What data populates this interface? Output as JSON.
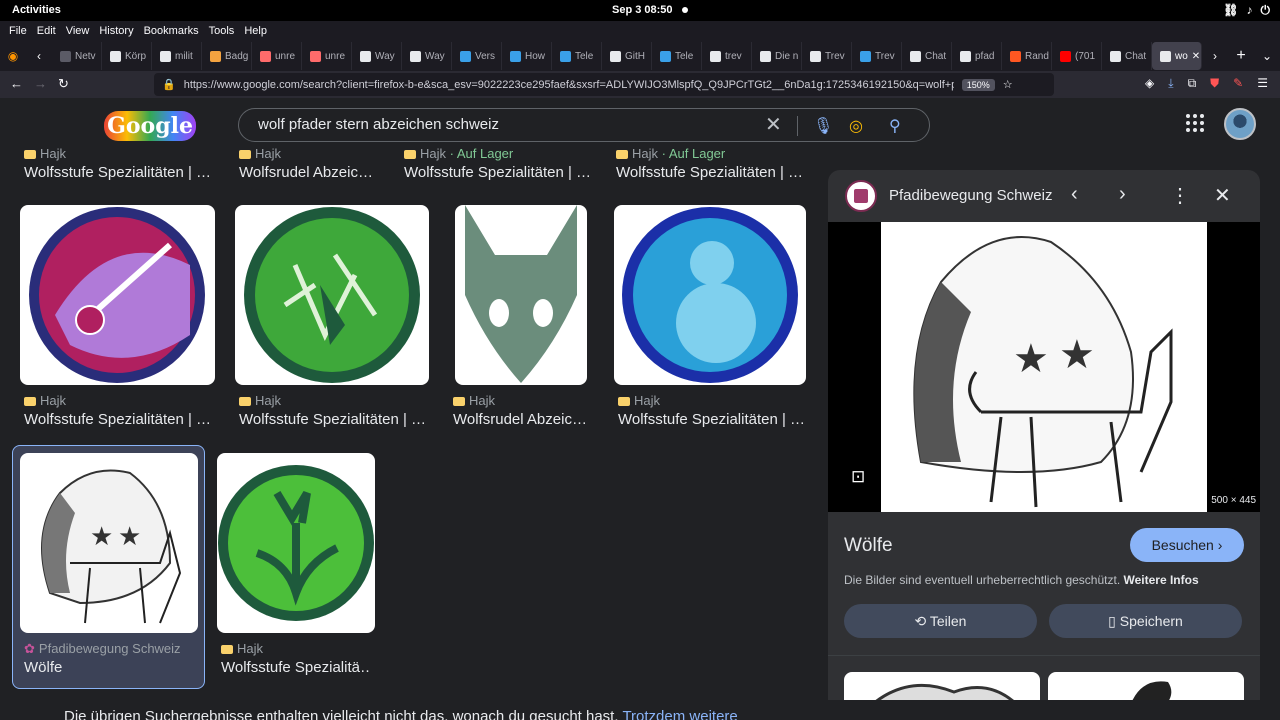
{
  "system": {
    "activities": "Activities",
    "clock": "Sep 3  08:50",
    "tray_icons": [
      "network-icon",
      "volume-icon",
      "power-icon"
    ]
  },
  "menubar": [
    "File",
    "Edit",
    "View",
    "History",
    "Bookmarks",
    "Tools",
    "Help"
  ],
  "tabs": [
    {
      "label": "Netv",
      "color": "#5b5b66"
    },
    {
      "label": "Körp",
      "color": "#e8eaed"
    },
    {
      "label": "milit",
      "color": "#e8eaed"
    },
    {
      "label": "Badg",
      "color": "#f4a340"
    },
    {
      "label": "unre",
      "color": "#ff6b6b"
    },
    {
      "label": "unre",
      "color": "#ff6b6b"
    },
    {
      "label": "Way",
      "color": "#e8eaed"
    },
    {
      "label": "Way",
      "color": "#e8eaed"
    },
    {
      "label": "Vers",
      "color": "#3aa0e8"
    },
    {
      "label": "How",
      "color": "#3aa0e8"
    },
    {
      "label": "Tele",
      "color": "#3aa0e8"
    },
    {
      "label": "GitH",
      "color": "#e8eaed"
    },
    {
      "label": "Tele",
      "color": "#3aa0e8"
    },
    {
      "label": "trev",
      "color": "#e8eaed"
    },
    {
      "label": "Die n",
      "color": "#e8eaed"
    },
    {
      "label": "Trev",
      "color": "#e8eaed"
    },
    {
      "label": "Trev",
      "color": "#3aa0e8"
    },
    {
      "label": "Chat",
      "color": "#e8eaed"
    },
    {
      "label": "pfad",
      "color": "#e8eaed"
    },
    {
      "label": "Rand",
      "color": "#ff5722"
    },
    {
      "label": "(701",
      "color": "#ff0000"
    },
    {
      "label": "Chat",
      "color": "#e8eaed"
    },
    {
      "label": "wo",
      "color": "#e8eaed",
      "active": true
    }
  ],
  "urlbar": {
    "url": "https://www.google.com/search?client=firefox-b-e&sca_esv=9022223ce295faef&sxsrf=ADLYWIJO3MlspfQ_Q9JPCrTGt2__6nDa1g:1725346192150&q=wolf+pfader+stern+",
    "zoom": "150%"
  },
  "search": {
    "logo_text": "Google",
    "query": "wolf pfader stern abzeichen schweiz"
  },
  "results": {
    "top_row": [
      {
        "source": "Hajk",
        "stock": "",
        "title": "Wolfsstufe Spezialitäten | …"
      },
      {
        "source": "Hajk",
        "stock": "",
        "title": "Wolfsrudel Abzeic…"
      },
      {
        "source": "Hajk",
        "stock": "· Auf Lager",
        "title": "Wolfsstufe Spezialitäten | …"
      },
      {
        "source": "Hajk",
        "stock": "· Auf Lager",
        "title": "Wolfsstufe Spezialitäten | …"
      }
    ],
    "row2": [
      {
        "source": "Hajk",
        "title": "Wolfsstufe Spezialitäten | …"
      },
      {
        "source": "Hajk",
        "title": "Wolfsstufe Spezialitäten | …"
      },
      {
        "source": "Hajk",
        "title": "Wolfsrudel Abzeic…"
      },
      {
        "source": "Hajk",
        "title": "Wolfsstufe Spezialitäten | …"
      }
    ],
    "row3": [
      {
        "source": "Pfadibewegung Schweiz",
        "title": "Wölfe"
      },
      {
        "source": "Hajk",
        "title": "Wolfsstufe Spezialitä…"
      }
    ],
    "bottom_text": "Die übrigen Suchergebnisse enthalten vielleicht nicht das, wonach du gesucht hast.",
    "bottom_link": "Trotzdem weitere"
  },
  "panel": {
    "source": "Pfadibewegung Schweiz",
    "dims": "500 × 445",
    "title": "Wölfe",
    "visit_label": "Besuchen",
    "copyright": "Die Bilder sind eventuell urheberrechtlich geschützt.",
    "more_info": "Weitere Infos",
    "share_label": "Teilen",
    "save_label": "Speichern"
  }
}
